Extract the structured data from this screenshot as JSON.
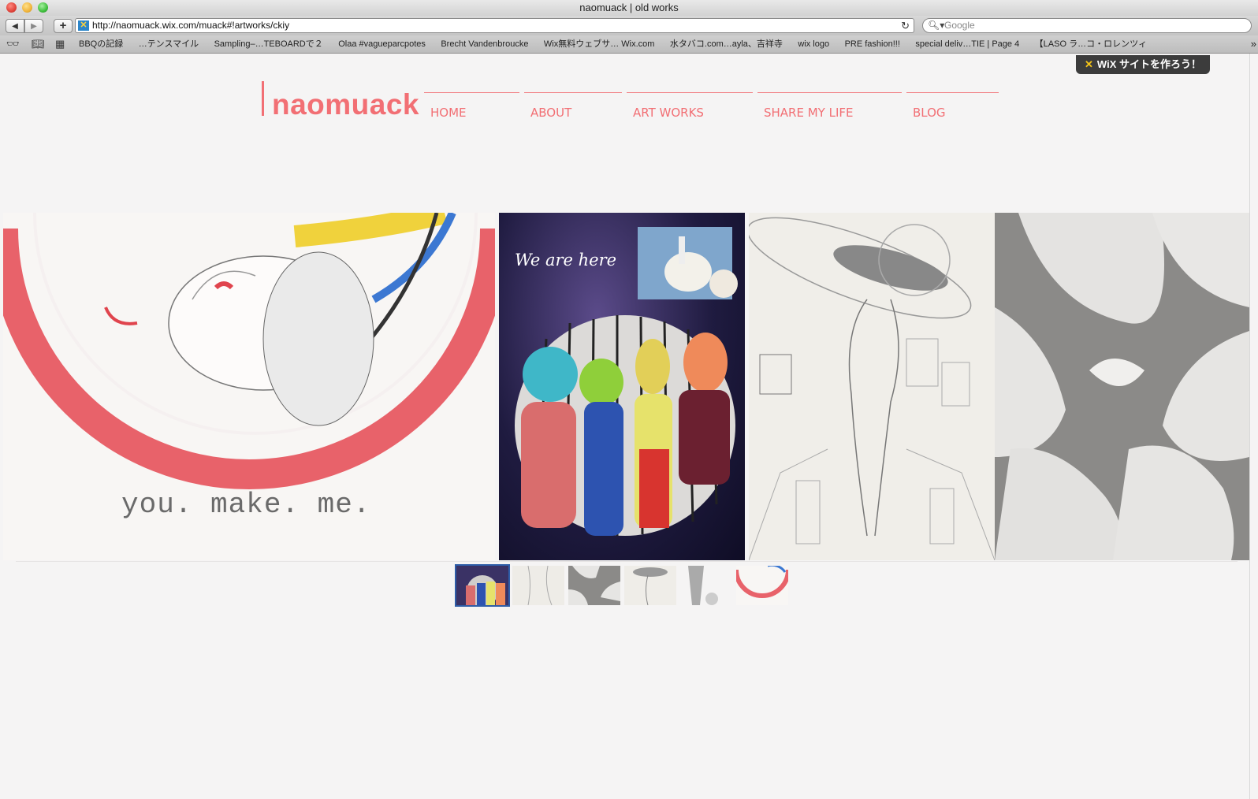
{
  "window": {
    "title": "naomuack | old works"
  },
  "toolbar": {
    "back_label": "◀",
    "forward_label": "▶",
    "add_label": "+",
    "url": "http://naomuack.wix.com/muack#!artworks/ckiy",
    "search_placeholder": "Google"
  },
  "bookmarks": [
    "BBQの記録",
    "…テンスマイル",
    "Sampling–…TEBOARDで２",
    "Olaa #vagueparcpotes",
    "Brecht Vandenbroucke",
    "Wix無料ウェブサ… Wix.com",
    "水タバコ.com…ayla、吉祥寺",
    "wix logo",
    "PRE fashion!!!",
    "special deliv…TIE | Page 4",
    "【LASO ラ…コ・ロレンツィ"
  ],
  "wix_badge": {
    "label": "WiX サイトを作ろう！"
  },
  "site": {
    "logo": "naomuack",
    "nav": [
      "HOME",
      "ABOUT",
      "ART WORKS",
      "SHARE MY LIFE",
      "BLOG"
    ]
  },
  "gallery": {
    "caption_1": "you. make. me.",
    "caption_2": "We are here"
  },
  "colors": {
    "accent": "#f26f74",
    "page_bg": "#f5f4f4",
    "badge_bg": "#3c3c3c"
  }
}
